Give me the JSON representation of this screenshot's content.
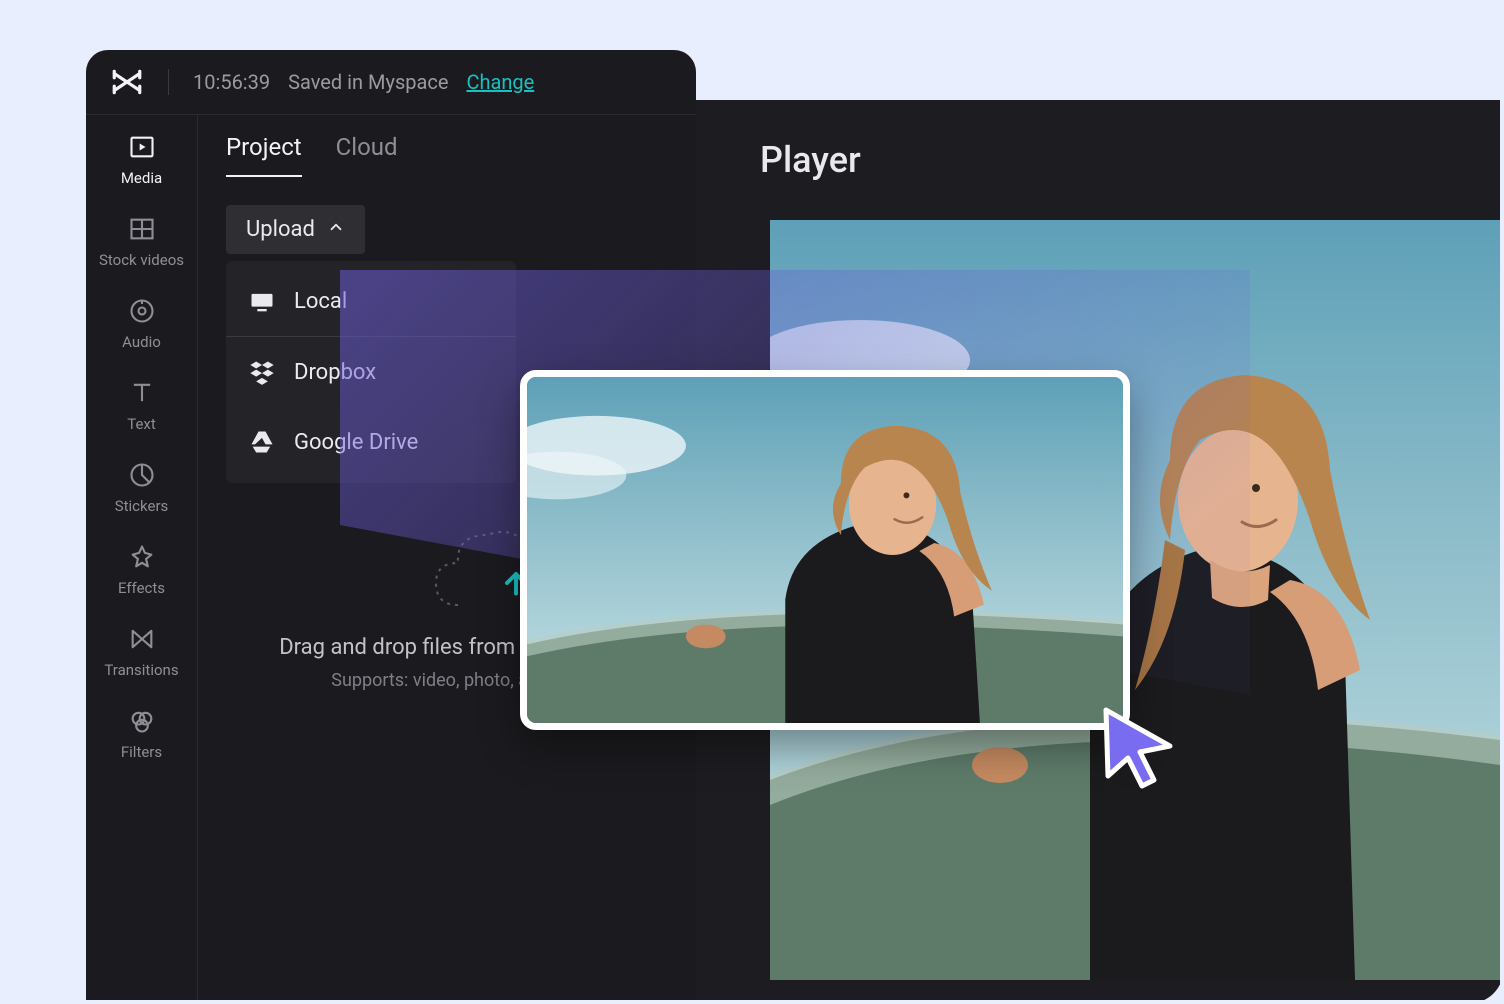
{
  "topbar": {
    "time": "10:56:39",
    "saved_text": "Saved in Myspace",
    "change_label": "Change"
  },
  "sidebar": {
    "items": [
      {
        "label": "Media"
      },
      {
        "label": "Stock videos"
      },
      {
        "label": "Audio"
      },
      {
        "label": "Text"
      },
      {
        "label": "Stickers"
      },
      {
        "label": "Effects"
      },
      {
        "label": "Transitions"
      },
      {
        "label": "Filters"
      }
    ]
  },
  "panel": {
    "tabs": {
      "project": "Project",
      "cloud": "Cloud"
    },
    "upload_label": "Upload",
    "menu": {
      "local": "Local",
      "dropbox": "Dropbox",
      "google_drive": "Google Drive"
    },
    "dropzone": {
      "line1": "Drag and drop files from computer",
      "line2": "Supports: video, photo, audio"
    }
  },
  "player": {
    "title": "Player"
  }
}
